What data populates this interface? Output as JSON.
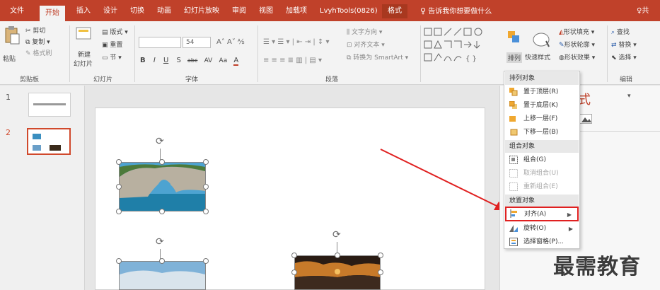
{
  "tabs": [
    "文件",
    "开始",
    "插入",
    "设计",
    "切换",
    "动画",
    "幻灯片放映",
    "审阅",
    "视图",
    "加载项",
    "LvyhTools(0826)",
    "格式"
  ],
  "tell_me": "告诉我你想要做什么",
  "user_glyph": "♀共",
  "clipboard": {
    "paste": "粘贴",
    "cut": "剪切",
    "copy": "复制",
    "format_painter": "格式刷",
    "label": "剪贴板"
  },
  "slides": {
    "new_slide": "新建",
    "new_slide2": "幻灯片",
    "layout": "版式",
    "reset": "重置",
    "section": "节",
    "label": "幻灯片"
  },
  "font": {
    "size": "54",
    "label": "字体",
    "style_buttons": [
      "B",
      "I",
      "U",
      "S",
      "abc",
      "AV",
      "Aa",
      "A"
    ]
  },
  "paragraph": {
    "text_direction": "文字方向",
    "align_text": "对齐文本",
    "convert_smartart": "转换为 SmartArt",
    "label": "段落"
  },
  "drawing": {
    "arrange": "排列",
    "quick_styles": "快速样式",
    "shape_fill": "形状填充",
    "shape_outline": "形状轮廓",
    "shape_effects": "形状效果"
  },
  "editing": {
    "find": "查找",
    "replace": "替换",
    "select": "选择",
    "label": "编辑"
  },
  "slide_numbers": [
    "1",
    "2"
  ],
  "pane_title_char": "式",
  "menu": {
    "h1": "排列对象",
    "bring_front": "置于顶层(R)",
    "send_back": "置于底层(K)",
    "forward": "上移一层(F)",
    "backward": "下移一层(B)",
    "h2": "组合对象",
    "group": "组合(G)",
    "ungroup": "取消组合(U)",
    "regroup": "重新组合(E)",
    "h3": "放置对象",
    "align": "对齐(A)",
    "rotate": "旋转(O)",
    "selection_pane": "选择窗格(P)..."
  },
  "watermark": "最需教育",
  "colors": {
    "accent": "#c0412a",
    "highlight": "#e02020"
  }
}
